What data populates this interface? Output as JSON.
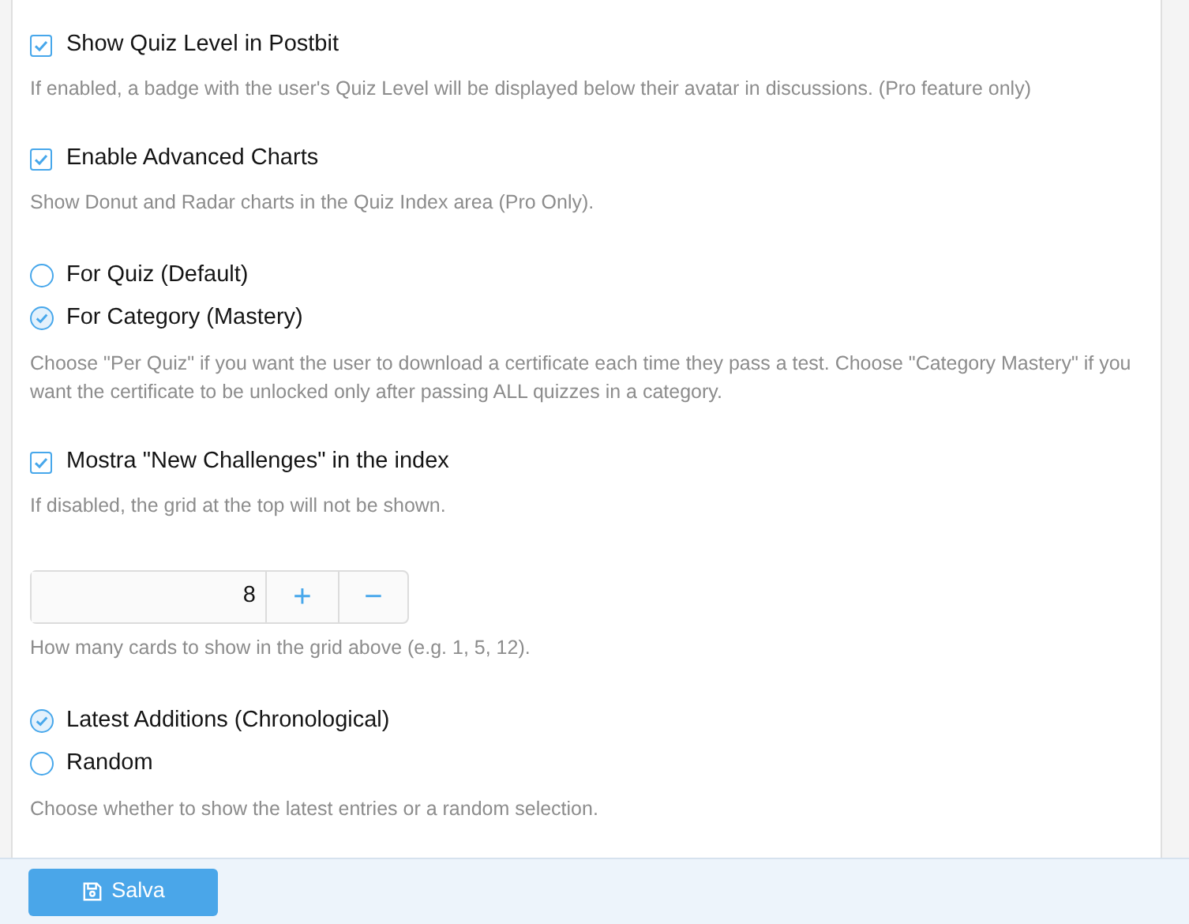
{
  "options": [
    {
      "kind": "checkbox",
      "label": "Show Quiz Level in Postbit",
      "checked": true,
      "hint": "If enabled, a badge with the user's Quiz Level will be displayed below their avatar in discussions. (Pro feature only)"
    },
    {
      "kind": "checkbox",
      "label": "Enable Advanced Charts",
      "checked": true,
      "hint": "Show Donut and Radar charts in the Quiz Index area (Pro Only)."
    },
    {
      "kind": "radio",
      "choices": [
        {
          "label": "For Quiz (Default)",
          "selected": false
        },
        {
          "label": "For Category (Mastery)",
          "selected": true
        }
      ],
      "hint": "Choose \"Per Quiz\" if you want the user to download a certificate each time they pass a test. Choose \"Category Mastery\" if you want the certificate to be unlocked only after passing ALL quizzes in a category."
    },
    {
      "kind": "checkbox",
      "label": "Mostra \"New Challenges\" in the index",
      "checked": true,
      "hint": "If disabled, the grid at the top will not be shown."
    },
    {
      "kind": "number",
      "value": "8",
      "plus": "+",
      "minus": "−",
      "hint": "How many cards to show in the grid above (e.g. 1, 5, 12)."
    },
    {
      "kind": "radio",
      "choices": [
        {
          "label": "Latest Additions (Chronological)",
          "selected": true
        },
        {
          "label": "Random",
          "selected": false
        }
      ],
      "hint": "Choose whether to show the latest entries or a random selection."
    }
  ],
  "save_button": {
    "label": "Salva"
  }
}
